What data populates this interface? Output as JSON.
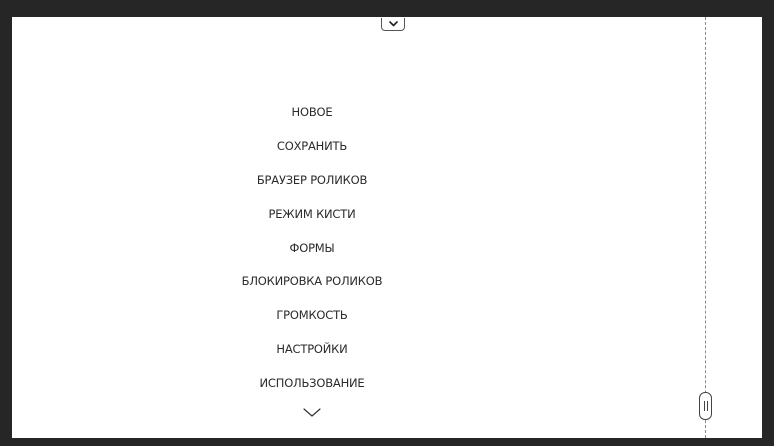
{
  "menu": {
    "items": [
      {
        "label": "НОВОЕ"
      },
      {
        "label": "СОХРАНИТЬ"
      },
      {
        "label": "БРАУЗЕР РОЛИКОВ"
      },
      {
        "label": "РЕЖИМ КИСТИ"
      },
      {
        "label": "ФОРМЫ"
      },
      {
        "label": "БЛОКИРОВКА РОЛИКОВ"
      },
      {
        "label": "ГРОМКОСТЬ"
      },
      {
        "label": "НАСТРОЙКИ"
      },
      {
        "label": "ИСПОЛЬЗОВАНИЕ"
      }
    ],
    "more_icon": "chevron-down-icon"
  },
  "top_tab": {
    "icon": "chevron-down-icon"
  },
  "divider_handle": {
    "icon": "drag-handle-icon"
  },
  "colors": {
    "frame": "#262626",
    "background": "#ffffff",
    "text": "#2b2b2b",
    "divider": "#8a8a8a"
  }
}
